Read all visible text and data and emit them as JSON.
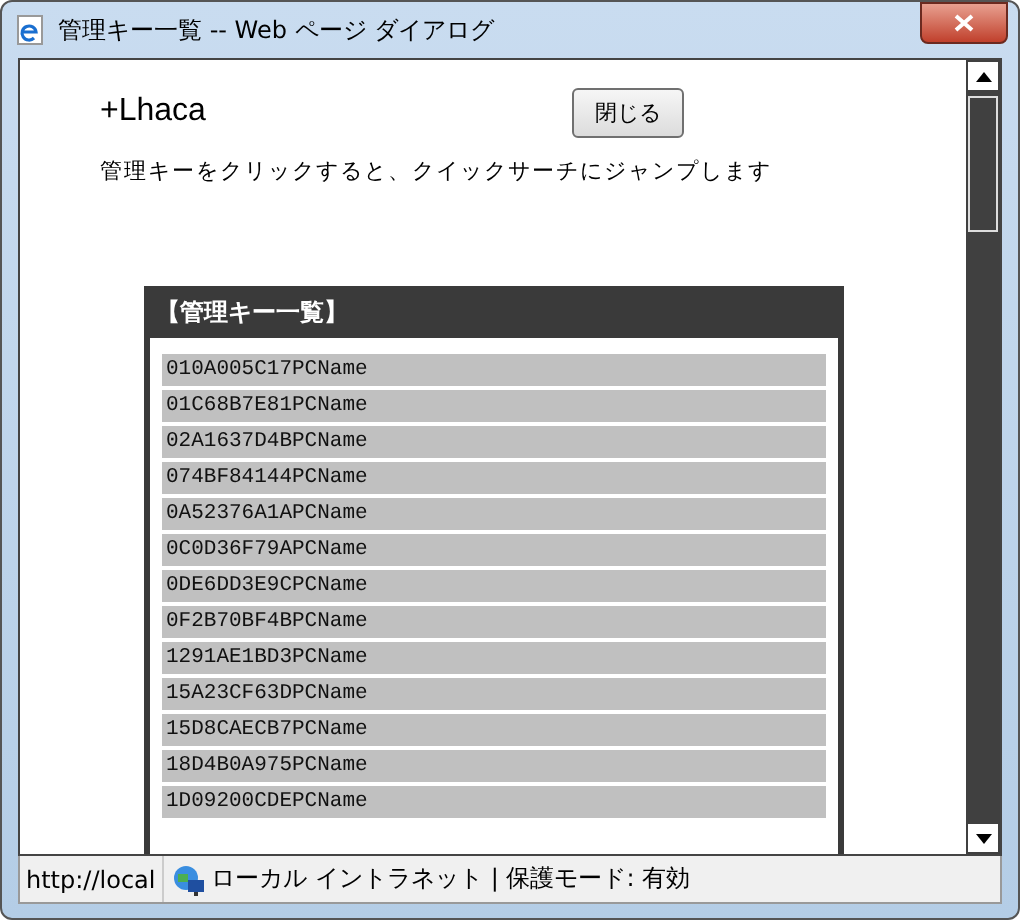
{
  "window": {
    "title": "管理キー一覧 -- Web ページ ダイアログ"
  },
  "page": {
    "heading": "+Lhaca",
    "close_button": "閉じる",
    "instruction": "管理キーをクリックすると、クイックサーチにジャンプします"
  },
  "panel": {
    "title": "【管理キー一覧】",
    "items": [
      "010A005C17PCName",
      "01C68B7E81PCName",
      "02A1637D4BPCName",
      "074BF84144PCName",
      "0A52376A1APCName",
      "0C0D36F79APCName",
      "0DE6DD3E9CPCName",
      "0F2B70BF4BPCName",
      "1291AE1BD3PCName",
      "15A23CF63DPCName",
      "15D8CAECB7PCName",
      "18D4B0A975PCName",
      "1D09200CDEPCName"
    ]
  },
  "status_bar": {
    "url": "http://local",
    "zone": "ローカル イントラネット | 保護モード: 有効"
  }
}
